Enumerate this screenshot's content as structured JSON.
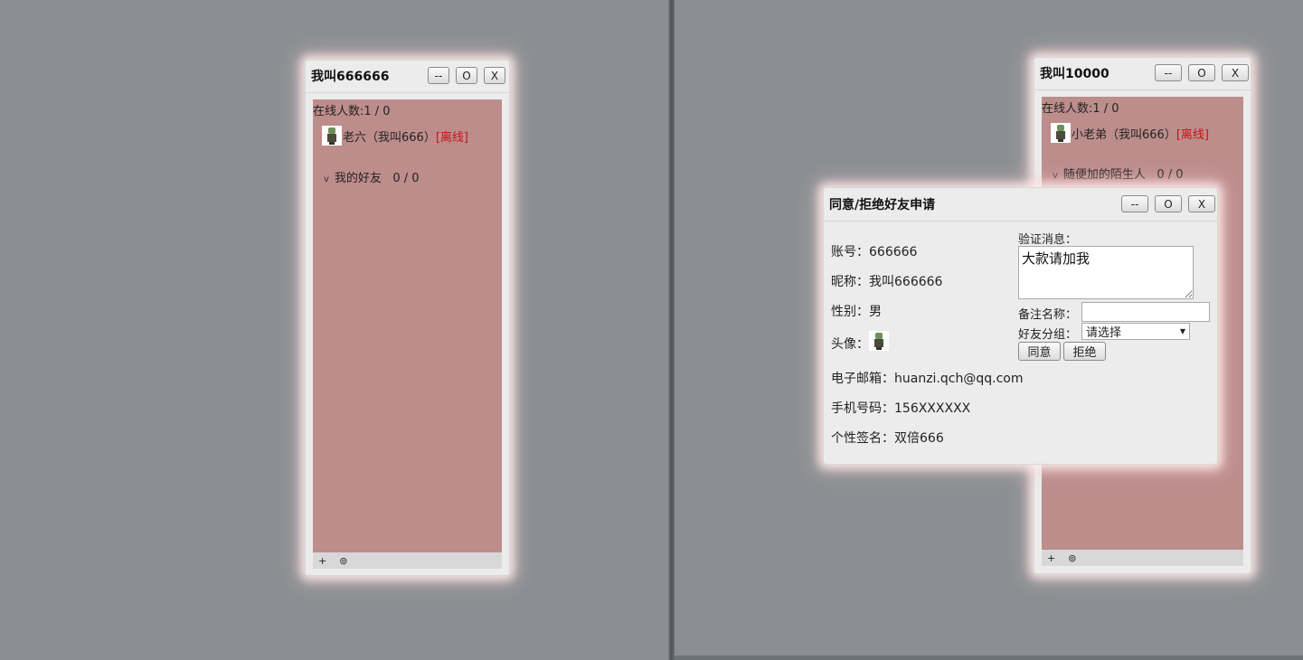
{
  "left_window": {
    "title": "我叫666666",
    "buttons": {
      "minimize": "--",
      "maximize": "O",
      "close": "X"
    },
    "online_count": "在线人数:1 / 0",
    "contacts": [
      {
        "name": "老六（我叫666）",
        "status": "[离线]"
      }
    ],
    "groups": [
      {
        "chevron": "v",
        "label": "我的好友",
        "count": "0 / 0"
      }
    ],
    "status_bar": {
      "add": "+",
      "settings": "⊚"
    }
  },
  "right_window": {
    "title": "我叫10000",
    "buttons": {
      "minimize": "--",
      "maximize": "O",
      "close": "X"
    },
    "online_count": "在线人数:1 / 0",
    "contacts": [
      {
        "name": "小老弟（我叫666）",
        "status": "[离线]"
      }
    ],
    "groups": [
      {
        "chevron": "v",
        "label": "随便加的陌生人",
        "count": "0 / 0"
      }
    ],
    "status_bar": {
      "add": "+",
      "settings": "⊚"
    }
  },
  "dialog": {
    "title": "同意/拒绝好友申请",
    "buttons": {
      "minimize": "--",
      "maximize": "O",
      "close": "X"
    },
    "info": {
      "account": "账号：666666",
      "nickname": "昵称：我叫666666",
      "gender": "性别：男",
      "avatar_label": "头像：",
      "email": "电子邮箱：huanzi.qch@qq.com",
      "phone": "手机号码：156XXXXXX",
      "signature": "个性签名：双倍666"
    },
    "verify_label": "验证消息：",
    "verify_message": "大款请加我",
    "remark_label": "备注名称：",
    "remark_value": "",
    "group_label": "好友分组：",
    "group_selected": "请选择",
    "accept_label": "同意",
    "reject_label": "拒绝"
  },
  "colors": {
    "desktop": "#8b8f93",
    "panel": "#bd8d8c",
    "offline": "#cc1111"
  }
}
